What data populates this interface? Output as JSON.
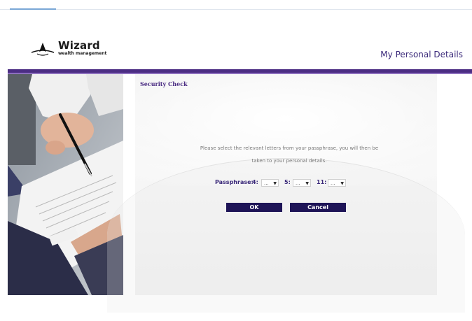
{
  "header": {
    "logo_name": "Wizard",
    "logo_tagline": "wealth management",
    "page_title": "My Personal Details"
  },
  "panel": {
    "title": "Security Check",
    "instruction_line1": "Please select the relevant letters from your passphrase, you will then be",
    "instruction_line2": "taken to your personal details.",
    "passphrase_label": "Passphrase:",
    "positions": [
      {
        "label": "4:",
        "value": "..."
      },
      {
        "label": "5:",
        "value": "..."
      },
      {
        "label": "11:",
        "value": "..."
      }
    ],
    "ok_label": "OK",
    "cancel_label": "Cancel"
  },
  "colors": {
    "brand_purple": "#4b2d83",
    "button_navy": "#1e1457",
    "title_purple": "#3b2a7a"
  },
  "icons": {
    "logo": "compass-arrow-icon",
    "select_arrow": "chevron-down-icon"
  }
}
